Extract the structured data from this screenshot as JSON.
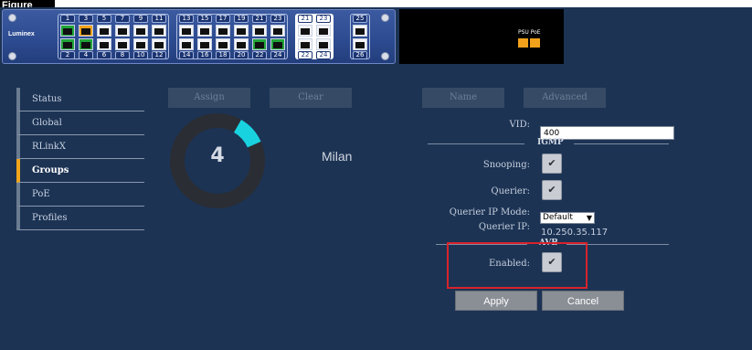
{
  "corner_label": "Figure",
  "device": {
    "brand": "Luminex",
    "port_groups": [
      {
        "columns": [
          [
            "1",
            "2"
          ],
          [
            "3",
            "4"
          ],
          [
            "5",
            "6"
          ],
          [
            "7",
            "8"
          ],
          [
            "9",
            "10"
          ],
          [
            "11",
            "12"
          ]
        ],
        "states": [
          [
            "green",
            "green"
          ],
          [
            "orange",
            "green"
          ],
          [
            "dark",
            "dark"
          ],
          [
            "dark",
            "dark"
          ],
          [
            "dark",
            "dark"
          ],
          [
            "dark",
            "dark"
          ]
        ]
      },
      {
        "columns": [
          [
            "13",
            "14"
          ],
          [
            "15",
            "16"
          ],
          [
            "17",
            "18"
          ],
          [
            "19",
            "20"
          ],
          [
            "21",
            "22"
          ],
          [
            "23",
            "24"
          ]
        ],
        "states": [
          [
            "dark",
            "dark"
          ],
          [
            "dark",
            "dark"
          ],
          [
            "dark",
            "dark"
          ],
          [
            "dark",
            "dark"
          ],
          [
            "dark",
            "green"
          ],
          [
            "dark",
            "green"
          ]
        ]
      },
      {
        "columns": [
          [
            "21",
            "22"
          ],
          [
            "23",
            "24"
          ]
        ],
        "states": [
          [
            "dark",
            "dark"
          ],
          [
            "dark",
            "dark"
          ]
        ]
      },
      {
        "columns": [
          [
            "25",
            "26"
          ]
        ],
        "states": [
          [
            "dark",
            "dark"
          ]
        ]
      }
    ],
    "psu_label": "PSU PoE",
    "psu_led_color": "#f2a11a"
  },
  "sidebar": {
    "items": [
      {
        "label": "Status",
        "active": false
      },
      {
        "label": "Global",
        "active": false
      },
      {
        "label": "RLinkX",
        "active": false
      },
      {
        "label": "Groups",
        "active": true
      },
      {
        "label": "PoE",
        "active": false
      },
      {
        "label": "Profiles",
        "active": false
      }
    ]
  },
  "toolbar": {
    "assign": "Assign",
    "clear": "Clear",
    "name": "Name",
    "advanced": "Advanced"
  },
  "group": {
    "number": "4",
    "name": "Milan",
    "ring_fill": 0.1,
    "ring_color": "#19d2e0"
  },
  "form": {
    "vid_label": "VID:",
    "vid_value": "400",
    "igmp_header": "IGMP",
    "snooping_label": "Snooping:",
    "snooping_checked": true,
    "querier_label": "Querier:",
    "querier_checked": true,
    "querier_ip_mode_label": "Querier IP Mode:",
    "querier_ip_mode_value": "Default",
    "querier_ip_label": "Querier IP:",
    "querier_ip_value": "10.250.35.117",
    "avb_header": "AVB",
    "enabled_label": "Enabled:",
    "enabled_checked": true,
    "check_glyph": "✔"
  },
  "actions": {
    "apply": "Apply",
    "cancel": "Cancel"
  }
}
